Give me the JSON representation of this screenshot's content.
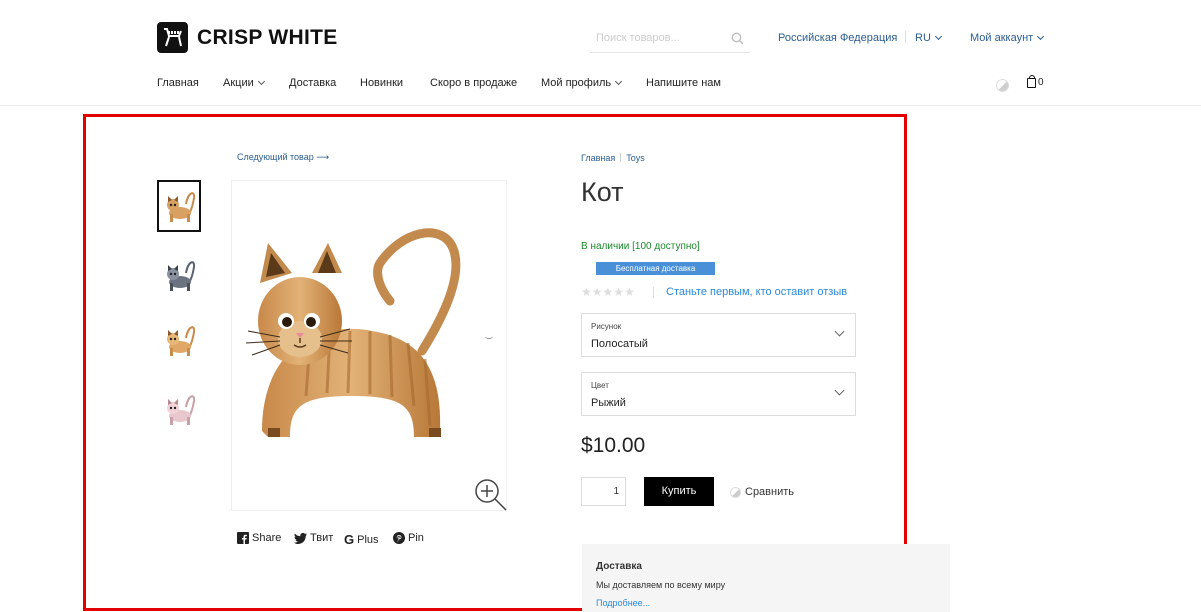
{
  "header": {
    "logo_text": "CRISP WHITE",
    "search_placeholder": "Поиск товаров...",
    "region": "Российская Федерация",
    "language": "RU",
    "account": "Мой аккаунт",
    "cart_count": "0"
  },
  "nav": {
    "items": [
      {
        "label": "Главная"
      },
      {
        "label": "Акции"
      },
      {
        "label": "Доставка"
      },
      {
        "label": "Новинки"
      },
      {
        "label": "Скоро в продаже"
      },
      {
        "label": "Мой профиль"
      },
      {
        "label": "Напишите нам"
      }
    ]
  },
  "product": {
    "next_link": "Следующий товар",
    "breadcrumb": [
      "Главная",
      "Toys"
    ],
    "title": "Кот",
    "stock": "В наличии [100 доступно]",
    "badge": "Бесплатная доставка",
    "rating": 0,
    "review_link": "Станьте первым, кто оставит отзыв",
    "options": [
      {
        "label": "Рисунок",
        "value": "Полосатый"
      },
      {
        "label": "Цвет",
        "value": "Рыжий"
      }
    ],
    "price": "$10.00",
    "quantity": "1",
    "buy_label": "Купить",
    "compare_label": "Сравнить",
    "share": [
      {
        "label": "Share",
        "icon": "facebook-icon"
      },
      {
        "label": "Твит",
        "icon": "twitter-icon"
      },
      {
        "label": "Plus",
        "icon": "google-plus-icon"
      },
      {
        "label": "Pin",
        "icon": "pinterest-icon"
      }
    ],
    "thumbnails": [
      "ginger-cat",
      "grey-cat",
      "ginger-cat-2",
      "pink-cat"
    ]
  },
  "delivery": {
    "heading": "Доставка",
    "text": "Мы доставляем по всему миру",
    "more": "Подробнее..."
  },
  "colors": {
    "accent_link": "#2a5d8f",
    "stock_green": "#1a8a2a",
    "badge_blue": "#4a90d9",
    "highlight_red": "#e30000",
    "buy_button": "#000000"
  }
}
